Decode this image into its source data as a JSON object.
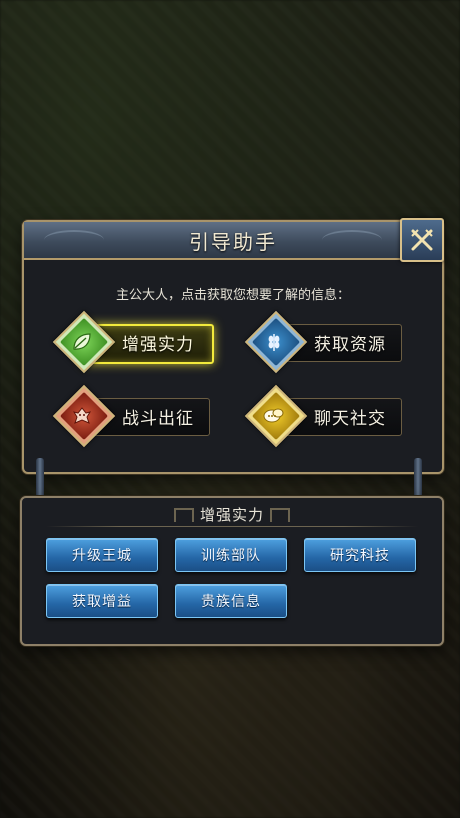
{
  "dialog": {
    "title": "引导助手",
    "subtitle": "主公大人，点击获取您想要了解的信息：",
    "options": [
      {
        "label": "增强实力",
        "icon": "leaf-icon",
        "color": "#5bbf3a",
        "selected": true
      },
      {
        "label": "获取资源",
        "icon": "wheat-icon",
        "color": "#2f7fb8",
        "selected": false
      },
      {
        "label": "战斗出征",
        "icon": "dragon-icon",
        "color": "#b23a26",
        "selected": false
      },
      {
        "label": "聊天社交",
        "icon": "chat-bubbles-icon",
        "color": "#d6b21c",
        "selected": false
      }
    ]
  },
  "section": {
    "title": "增强实力",
    "buttons": [
      "升级王城",
      "训练部队",
      "研究科技",
      "获取增益",
      "贵族信息"
    ]
  },
  "colors": {
    "accent_gold": "#f2ea3c",
    "button_blue": "#2f7fc4",
    "frame": "#a8946a"
  }
}
